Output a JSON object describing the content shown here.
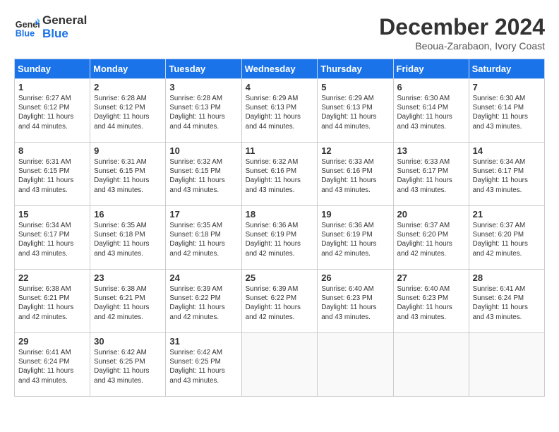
{
  "logo": {
    "line1": "General",
    "line2": "Blue"
  },
  "title": "December 2024",
  "location": "Beoua-Zarabaon, Ivory Coast",
  "days_of_week": [
    "Sunday",
    "Monday",
    "Tuesday",
    "Wednesday",
    "Thursday",
    "Friday",
    "Saturday"
  ],
  "weeks": [
    [
      {
        "day": 1,
        "info": "Sunrise: 6:27 AM\nSunset: 6:12 PM\nDaylight: 11 hours\nand 44 minutes."
      },
      {
        "day": 2,
        "info": "Sunrise: 6:28 AM\nSunset: 6:12 PM\nDaylight: 11 hours\nand 44 minutes."
      },
      {
        "day": 3,
        "info": "Sunrise: 6:28 AM\nSunset: 6:13 PM\nDaylight: 11 hours\nand 44 minutes."
      },
      {
        "day": 4,
        "info": "Sunrise: 6:29 AM\nSunset: 6:13 PM\nDaylight: 11 hours\nand 44 minutes."
      },
      {
        "day": 5,
        "info": "Sunrise: 6:29 AM\nSunset: 6:13 PM\nDaylight: 11 hours\nand 44 minutes."
      },
      {
        "day": 6,
        "info": "Sunrise: 6:30 AM\nSunset: 6:14 PM\nDaylight: 11 hours\nand 43 minutes."
      },
      {
        "day": 7,
        "info": "Sunrise: 6:30 AM\nSunset: 6:14 PM\nDaylight: 11 hours\nand 43 minutes."
      }
    ],
    [
      {
        "day": 8,
        "info": "Sunrise: 6:31 AM\nSunset: 6:15 PM\nDaylight: 11 hours\nand 43 minutes."
      },
      {
        "day": 9,
        "info": "Sunrise: 6:31 AM\nSunset: 6:15 PM\nDaylight: 11 hours\nand 43 minutes."
      },
      {
        "day": 10,
        "info": "Sunrise: 6:32 AM\nSunset: 6:15 PM\nDaylight: 11 hours\nand 43 minutes."
      },
      {
        "day": 11,
        "info": "Sunrise: 6:32 AM\nSunset: 6:16 PM\nDaylight: 11 hours\nand 43 minutes."
      },
      {
        "day": 12,
        "info": "Sunrise: 6:33 AM\nSunset: 6:16 PM\nDaylight: 11 hours\nand 43 minutes."
      },
      {
        "day": 13,
        "info": "Sunrise: 6:33 AM\nSunset: 6:17 PM\nDaylight: 11 hours\nand 43 minutes."
      },
      {
        "day": 14,
        "info": "Sunrise: 6:34 AM\nSunset: 6:17 PM\nDaylight: 11 hours\nand 43 minutes."
      }
    ],
    [
      {
        "day": 15,
        "info": "Sunrise: 6:34 AM\nSunset: 6:17 PM\nDaylight: 11 hours\nand 43 minutes."
      },
      {
        "day": 16,
        "info": "Sunrise: 6:35 AM\nSunset: 6:18 PM\nDaylight: 11 hours\nand 43 minutes."
      },
      {
        "day": 17,
        "info": "Sunrise: 6:35 AM\nSunset: 6:18 PM\nDaylight: 11 hours\nand 42 minutes."
      },
      {
        "day": 18,
        "info": "Sunrise: 6:36 AM\nSunset: 6:19 PM\nDaylight: 11 hours\nand 42 minutes."
      },
      {
        "day": 19,
        "info": "Sunrise: 6:36 AM\nSunset: 6:19 PM\nDaylight: 11 hours\nand 42 minutes."
      },
      {
        "day": 20,
        "info": "Sunrise: 6:37 AM\nSunset: 6:20 PM\nDaylight: 11 hours\nand 42 minutes."
      },
      {
        "day": 21,
        "info": "Sunrise: 6:37 AM\nSunset: 6:20 PM\nDaylight: 11 hours\nand 42 minutes."
      }
    ],
    [
      {
        "day": 22,
        "info": "Sunrise: 6:38 AM\nSunset: 6:21 PM\nDaylight: 11 hours\nand 42 minutes."
      },
      {
        "day": 23,
        "info": "Sunrise: 6:38 AM\nSunset: 6:21 PM\nDaylight: 11 hours\nand 42 minutes."
      },
      {
        "day": 24,
        "info": "Sunrise: 6:39 AM\nSunset: 6:22 PM\nDaylight: 11 hours\nand 42 minutes."
      },
      {
        "day": 25,
        "info": "Sunrise: 6:39 AM\nSunset: 6:22 PM\nDaylight: 11 hours\nand 42 minutes."
      },
      {
        "day": 26,
        "info": "Sunrise: 6:40 AM\nSunset: 6:23 PM\nDaylight: 11 hours\nand 43 minutes."
      },
      {
        "day": 27,
        "info": "Sunrise: 6:40 AM\nSunset: 6:23 PM\nDaylight: 11 hours\nand 43 minutes."
      },
      {
        "day": 28,
        "info": "Sunrise: 6:41 AM\nSunset: 6:24 PM\nDaylight: 11 hours\nand 43 minutes."
      }
    ],
    [
      {
        "day": 29,
        "info": "Sunrise: 6:41 AM\nSunset: 6:24 PM\nDaylight: 11 hours\nand 43 minutes."
      },
      {
        "day": 30,
        "info": "Sunrise: 6:42 AM\nSunset: 6:25 PM\nDaylight: 11 hours\nand 43 minutes."
      },
      {
        "day": 31,
        "info": "Sunrise: 6:42 AM\nSunset: 6:25 PM\nDaylight: 11 hours\nand 43 minutes."
      },
      null,
      null,
      null,
      null
    ]
  ]
}
